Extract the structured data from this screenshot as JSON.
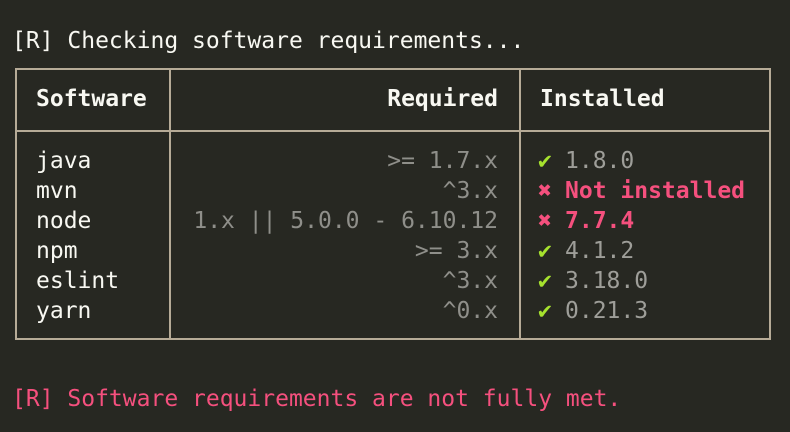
{
  "terminal": {
    "header": "[R] Checking software requirements...",
    "footer": "[R] Software requirements are not fully met."
  },
  "table": {
    "columns": [
      "Software",
      "Required",
      "Installed"
    ],
    "rows": [
      {
        "software": "java",
        "required": ">= 1.7.x",
        "status": "ok",
        "status_icon": "✔",
        "installed": "1.8.0"
      },
      {
        "software": "mvn",
        "required": "^3.x",
        "status": "bad",
        "status_icon": "✖",
        "installed": "Not installed"
      },
      {
        "software": "node",
        "required": "1.x || 5.0.0 - 6.10.12",
        "status": "bad",
        "status_icon": "✖",
        "installed": "7.7.4"
      },
      {
        "software": "npm",
        "required": ">= 3.x",
        "status": "ok",
        "status_icon": "✔",
        "installed": "4.1.2"
      },
      {
        "software": "eslint",
        "required": "^3.x",
        "status": "ok",
        "status_icon": "✔",
        "installed": "3.18.0"
      },
      {
        "software": "yarn",
        "required": "^0.x",
        "status": "ok",
        "status_icon": "✔",
        "installed": "0.21.3"
      }
    ]
  },
  "colors": {
    "background": "#272822",
    "border": "#b6ab97",
    "ok": "#a6e22e",
    "error": "#f5507e",
    "muted": "#8f8f8a"
  }
}
